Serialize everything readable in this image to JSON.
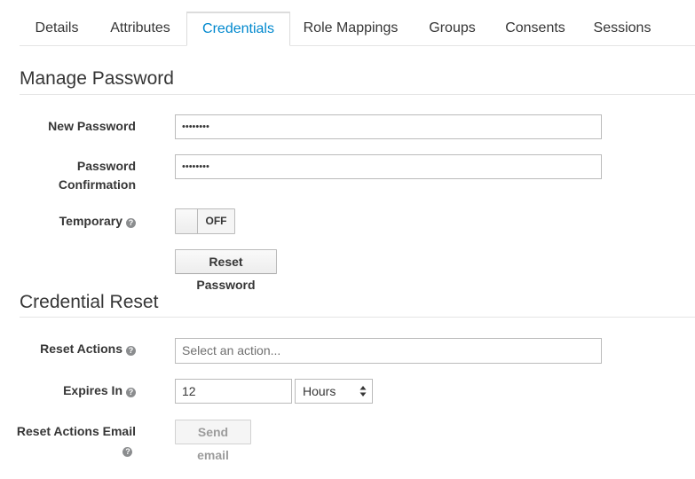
{
  "tabs": [
    {
      "label": "Details",
      "active": false
    },
    {
      "label": "Attributes",
      "active": false
    },
    {
      "label": "Credentials",
      "active": true
    },
    {
      "label": "Role Mappings",
      "active": false
    },
    {
      "label": "Groups",
      "active": false
    },
    {
      "label": "Consents",
      "active": false
    },
    {
      "label": "Sessions",
      "active": false
    }
  ],
  "manage_password": {
    "title": "Manage Password",
    "new_password_label": "New Password",
    "new_password_value": "••••••••",
    "confirmation_label_line1": "Password",
    "confirmation_label_line2": "Confirmation",
    "confirmation_value": "••••••••",
    "temporary_label": "Temporary",
    "temporary_state": "OFF",
    "reset_button": "Reset Password"
  },
  "credential_reset": {
    "title": "Credential Reset",
    "reset_actions_label": "Reset Actions",
    "reset_actions_placeholder": "Select an action...",
    "expires_label": "Expires In",
    "expires_value": "12",
    "expires_unit": "Hours",
    "email_label": "Reset Actions Email",
    "send_email_button": "Send email"
  },
  "help_glyph": "?",
  "colors": {
    "active_tab": "#0088ce",
    "text": "#363636",
    "border": "#bbbbbb",
    "help_icon": "#8b8d8f"
  }
}
